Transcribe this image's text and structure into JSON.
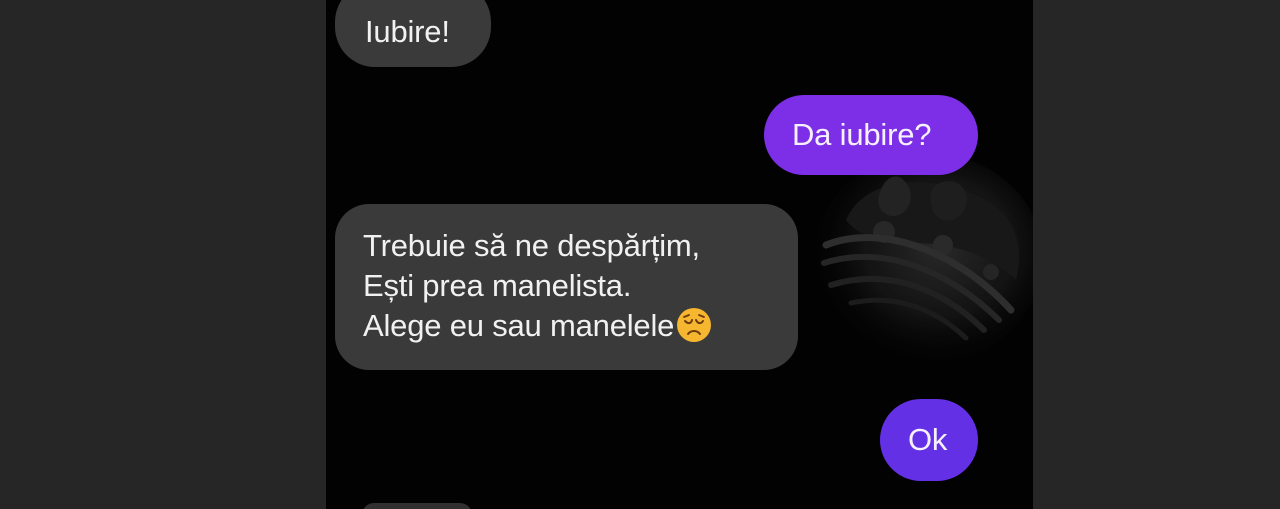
{
  "conversation": {
    "messages": [
      {
        "text": "Iubire!",
        "direction": "incoming"
      },
      {
        "text": "Da iubire?",
        "direction": "outgoing"
      },
      {
        "lines": [
          "Trebuie să ne despărțim,",
          "Ești prea manelista.",
          "Alege eu sau manelele"
        ],
        "emoji": "disappointed-face-emoji",
        "direction": "incoming"
      },
      {
        "text": "Ok",
        "direction": "outgoing"
      }
    ]
  },
  "colors": {
    "background": "#262626",
    "chat_background": "#020202",
    "incoming_bubble": "#3a3a3a",
    "outgoing_bubble": "#7c2fe6",
    "outgoing_bubble_short": "#6430e6",
    "text": "#f1f1f1"
  },
  "decorations": {
    "wallpaper_icon": "crown-icon"
  }
}
